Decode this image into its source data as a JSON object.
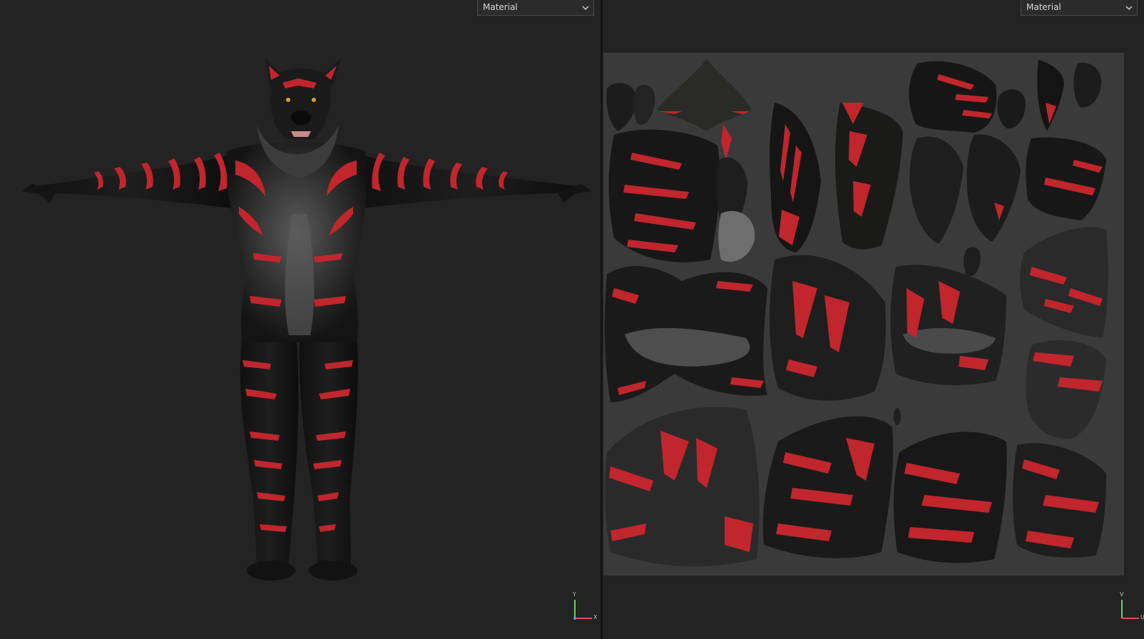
{
  "viewport_3d": {
    "shading_mode": "Material",
    "axis_labels": {
      "vertical": "Y",
      "horizontal": "X"
    }
  },
  "viewport_uv": {
    "shading_mode": "Material",
    "axis_labels": {
      "vertical": "V",
      "horizontal": "U"
    }
  },
  "icons": {
    "dropdown_arrow": "chevron-down-icon"
  },
  "colors": {
    "background": "#232323",
    "uv_canvas": "#3a3a3a",
    "fur_dark": "#151515",
    "fur_grey": "#4a4a4a",
    "stripe_red": "#c0262c",
    "axis_green": "#6fcf5a",
    "axis_red": "#e05050"
  }
}
